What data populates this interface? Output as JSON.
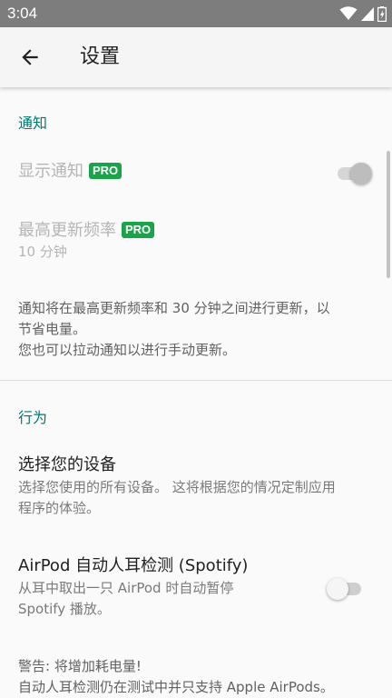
{
  "status_bar": {
    "time": "3:04",
    "icons": [
      "wifi-icon",
      "cell-signal-icon",
      "battery-icon"
    ]
  },
  "app_bar": {
    "back_icon": "arrow-back-icon",
    "title": "设置"
  },
  "sections": {
    "notifications": {
      "header": "通知",
      "show_notification": {
        "label": "显示通知",
        "badge": "PRO",
        "switch_on": true,
        "enabled": false
      },
      "max_update_rate": {
        "label": "最高更新频率",
        "badge": "PRO",
        "value": "10 分钟",
        "enabled": false
      },
      "info_line1": "通知将在最高更新频率和 30 分钟之间进行更新，以",
      "info_line2": "节省电量。",
      "info_line3": "您也可以拉动通知以进行手动更新。"
    },
    "behavior": {
      "header": "行为",
      "select_devices": {
        "title": "选择您的设备",
        "sub_line1": "选择您使用的所有设备。 这将根据您的情况定制应用",
        "sub_line2": "程序的体验。"
      },
      "auto_ear_detection": {
        "title": "AirPod 自动人耳检测 (Spotify)",
        "sub_line1": "从耳中取出一只 AirPod 时自动暂停",
        "sub_line2": "Spotify 播放。",
        "switch_on": false
      },
      "warning_line1": "警告: 将增加耗电量!",
      "warning_line2": "自动人耳检测仍在测试中并只支持 Apple AirPods。"
    }
  },
  "colors": {
    "accent": "#00796b",
    "pro_badge": "#1aa34a",
    "status_bar": "#7d7d7d"
  }
}
